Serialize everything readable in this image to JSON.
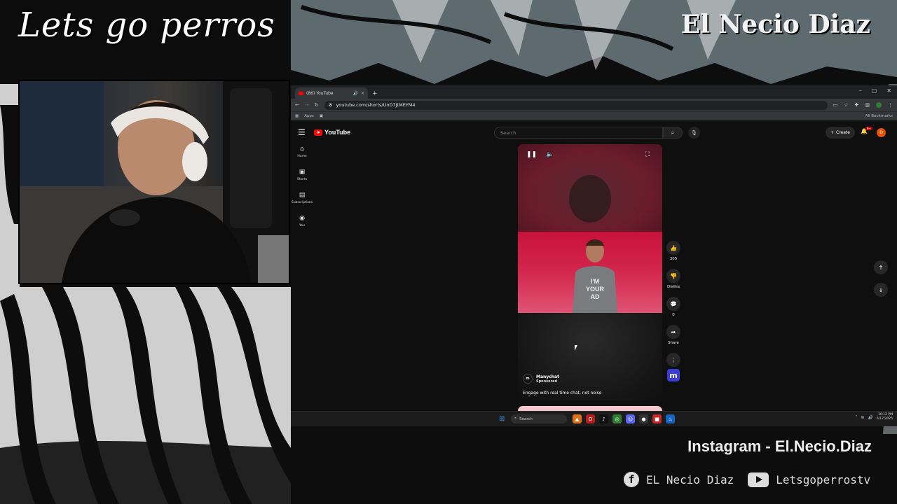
{
  "overlay": {
    "title": "Lets go perros",
    "brand": "El Necio Diaz",
    "instagram": "Instagram - El.Necio.Diaz",
    "facebook_label": "EL Necio Diaz",
    "youtube_label": "Letsgoperrostv",
    "facebook_icon_glyph": "f"
  },
  "browser": {
    "tab_title": "(86) YouTube",
    "tab_close": "×",
    "tab_audio": "🔊",
    "new_tab": "+",
    "url": "youtube.com/shorts/UnD7JtMEYM4",
    "bookmarks_apps": "Apps",
    "all_bookmarks": "All Bookmarks",
    "win_controls": [
      "–",
      "▢",
      "✕"
    ]
  },
  "youtube": {
    "logo_text": "YouTube",
    "search_placeholder": "Search",
    "create_label": "Create",
    "notification_badge": "9+",
    "avatar_letter": "D",
    "sidebar": [
      {
        "label": "Home",
        "icon": "home-icon",
        "glyph": "⌂"
      },
      {
        "label": "Shorts",
        "icon": "shorts-icon",
        "glyph": "▣"
      },
      {
        "label": "Subscriptions",
        "icon": "subscriptions-icon",
        "glyph": "▤"
      },
      {
        "label": "You",
        "icon": "you-icon",
        "glyph": "◉"
      }
    ],
    "short": {
      "channel_name": "Manychat",
      "channel_logo": "m",
      "sponsored_label": "Sponsored",
      "description": "Engage with real time chat, not noise",
      "shirt_text": "I'M YOUR AD"
    },
    "actions": {
      "like_count": "305",
      "dislike_label": "Dislike",
      "comment_count": "0",
      "share_label": "Share",
      "more_glyph": "⋮",
      "manychat_glyph": "m"
    }
  },
  "taskbar": {
    "search_label": "Search",
    "time": "10:12 PM",
    "date": "6/17/2025"
  },
  "colors": {
    "youtube_red": "#ff0000",
    "short_background": "#d3274d",
    "manychat_brand": "#3a3dd6"
  }
}
